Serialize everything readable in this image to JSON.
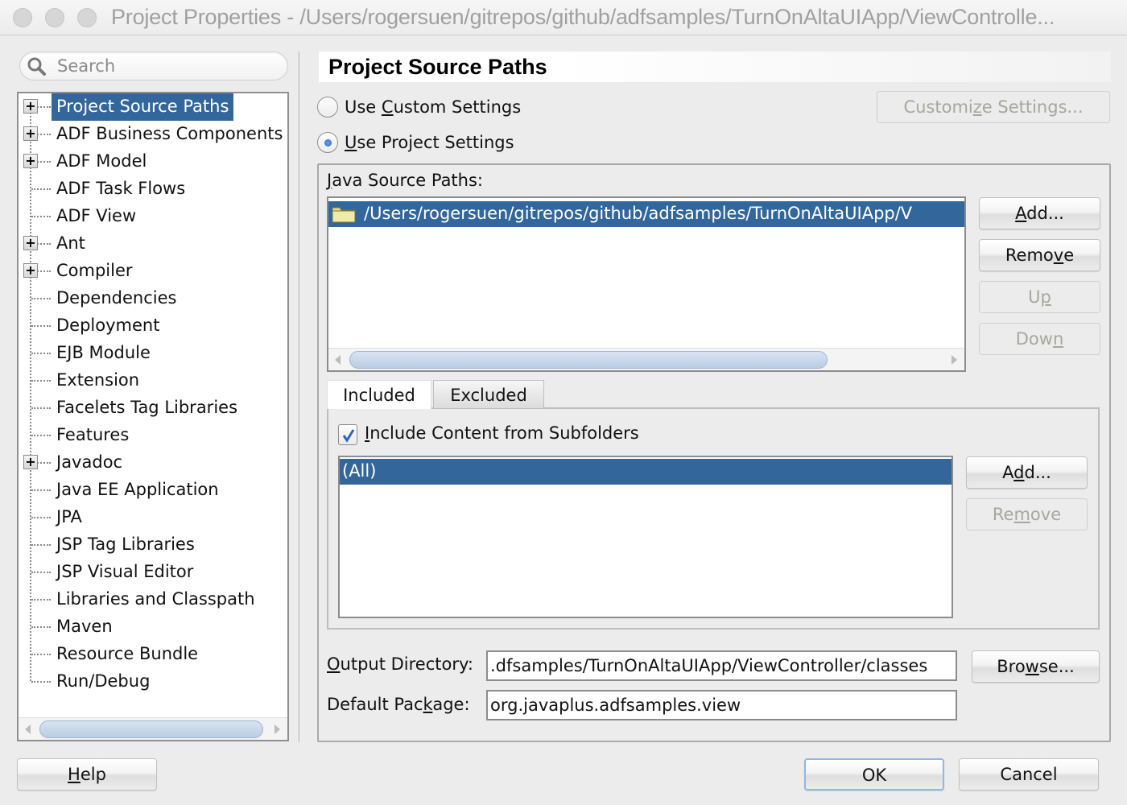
{
  "window": {
    "title": "Project Properties - /Users/rogersuen/gitrepos/github/adfsamples/TurnOnAltaUIApp/ViewControlle..."
  },
  "search": {
    "placeholder": "Search"
  },
  "tree": {
    "items": [
      {
        "label": "Project Source Paths",
        "expandable": true,
        "selected": true
      },
      {
        "label": "ADF Business Components",
        "expandable": true
      },
      {
        "label": "ADF Model",
        "expandable": true
      },
      {
        "label": "ADF Task Flows",
        "expandable": false
      },
      {
        "label": "ADF View",
        "expandable": false
      },
      {
        "label": "Ant",
        "expandable": true
      },
      {
        "label": "Compiler",
        "expandable": true
      },
      {
        "label": "Dependencies",
        "expandable": false
      },
      {
        "label": "Deployment",
        "expandable": false
      },
      {
        "label": "EJB Module",
        "expandable": false
      },
      {
        "label": "Extension",
        "expandable": false
      },
      {
        "label": "Facelets Tag Libraries",
        "expandable": false
      },
      {
        "label": "Features",
        "expandable": false
      },
      {
        "label": "Javadoc",
        "expandable": true
      },
      {
        "label": "Java EE Application",
        "expandable": false
      },
      {
        "label": "JPA",
        "expandable": false
      },
      {
        "label": "JSP Tag Libraries",
        "expandable": false
      },
      {
        "label": "JSP Visual Editor",
        "expandable": false
      },
      {
        "label": "Libraries and Classpath",
        "expandable": false
      },
      {
        "label": "Maven",
        "expandable": false
      },
      {
        "label": "Resource Bundle",
        "expandable": false
      },
      {
        "label": "Run/Debug",
        "expandable": false
      }
    ]
  },
  "main": {
    "title": "Project Source Paths",
    "radio_custom": {
      "label": "Use Custom Settings",
      "mnemonic_index": 4,
      "checked": false
    },
    "radio_project": {
      "label": "Use Project Settings",
      "mnemonic_index": 0,
      "checked": true
    },
    "customize_button": {
      "label": "Customize Settings...",
      "enabled": false
    },
    "java_source_paths": {
      "label": "Java Source Paths:",
      "items": [
        "/Users/rogersuen/gitrepos/github/adfsamples/TurnOnAltaUIApp/V"
      ],
      "selected_index": 0
    },
    "path_buttons": {
      "add": {
        "label": "Add...",
        "enabled": true
      },
      "remove": {
        "label": "Remove",
        "enabled": true
      },
      "up": {
        "label": "Up",
        "enabled": false
      },
      "down": {
        "label": "Down",
        "enabled": false
      }
    },
    "tabs": [
      {
        "label": "Included",
        "active": true
      },
      {
        "label": "Excluded",
        "active": false
      }
    ],
    "include_subfolders": {
      "label": "Include Content from Subfolders",
      "checked": true
    },
    "included_list": {
      "items": [
        "(All)"
      ],
      "selected_index": 0
    },
    "included_buttons": {
      "add": {
        "label": "Add...",
        "enabled": true
      },
      "remove": {
        "label": "Remove",
        "enabled": false
      }
    },
    "output_directory": {
      "label": "Output Directory:",
      "value": ".dfsamples/TurnOnAltaUIApp/ViewController/classes",
      "browse_label": "Browse..."
    },
    "default_package": {
      "label": "Default Package:",
      "value": "org.javaplus.adfsamples.view"
    }
  },
  "footer": {
    "help_label": "Help",
    "ok_label": "OK",
    "cancel_label": "Cancel"
  }
}
